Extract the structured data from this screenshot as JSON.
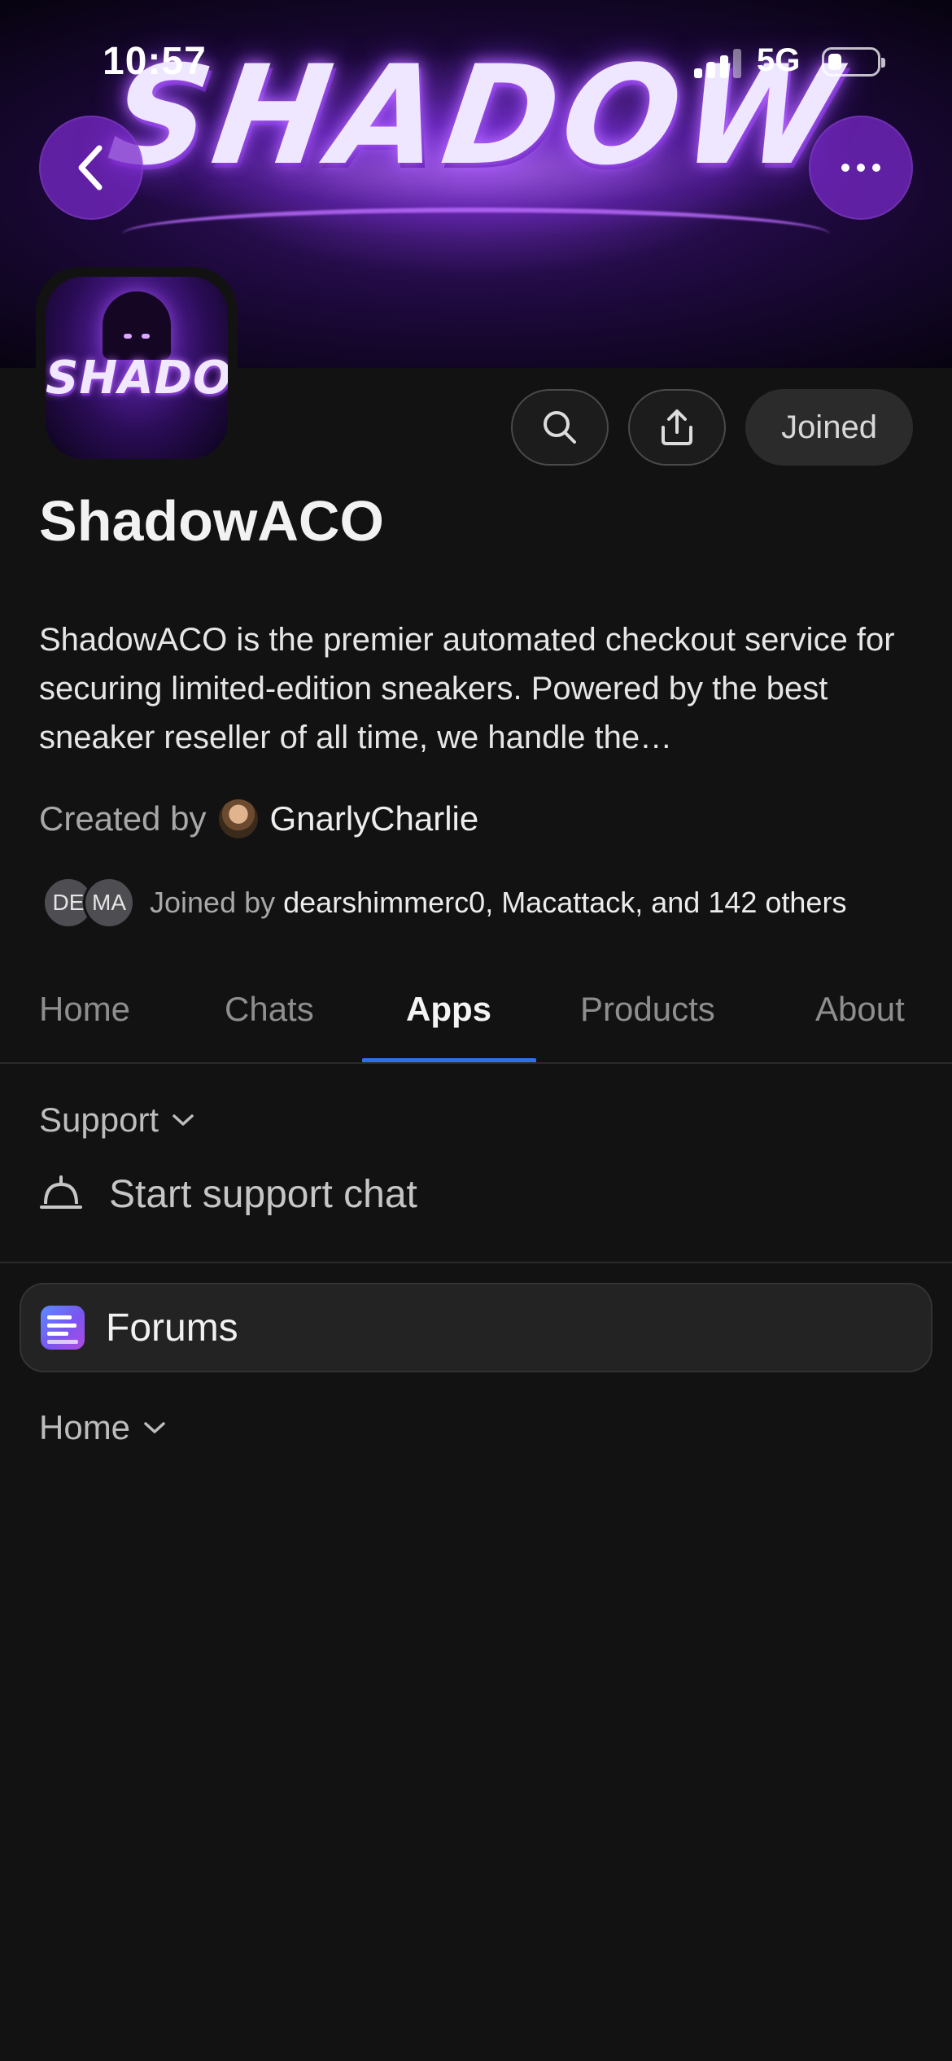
{
  "status_bar": {
    "time": "10:57",
    "network": "5G",
    "signal_bars": 3,
    "signal_bars_total": 4,
    "battery_level": 0.2
  },
  "banner": {
    "title": "SHADOW"
  },
  "avatar": {
    "wordmark": "SHADOW"
  },
  "actions": {
    "joined_label": "Joined"
  },
  "community": {
    "name": "ShadowACO",
    "description": "ShadowACO is the premier automated checkout service for securing limited-edition sneakers. Powered by the best sneaker reseller of all time, we handle the…",
    "created_by_label": "Created by",
    "creator_name": "GnarlyCharlie",
    "member_initials": [
      "DE",
      "MA"
    ],
    "joined_by_label": "Joined by",
    "joined_by_names": "dearshimmerc0, Macattack, and 142 others"
  },
  "tabs": [
    {
      "label": "Home"
    },
    {
      "label": "Chats"
    },
    {
      "label": "Apps",
      "active": true
    },
    {
      "label": "Products"
    },
    {
      "label": "About"
    }
  ],
  "apps": {
    "support_section": "Support",
    "support_chat_label": "Start support chat",
    "forums_label": "Forums",
    "home_section": "Home"
  },
  "colors": {
    "background": "#121212",
    "accent_blue": "#2f6fe8",
    "banner_purple": "#7a2fe0"
  },
  "icons": [
    "back-icon",
    "more-icon",
    "search-icon",
    "share-icon",
    "chevron-down-icon",
    "bell-icon",
    "forums-icon"
  ]
}
